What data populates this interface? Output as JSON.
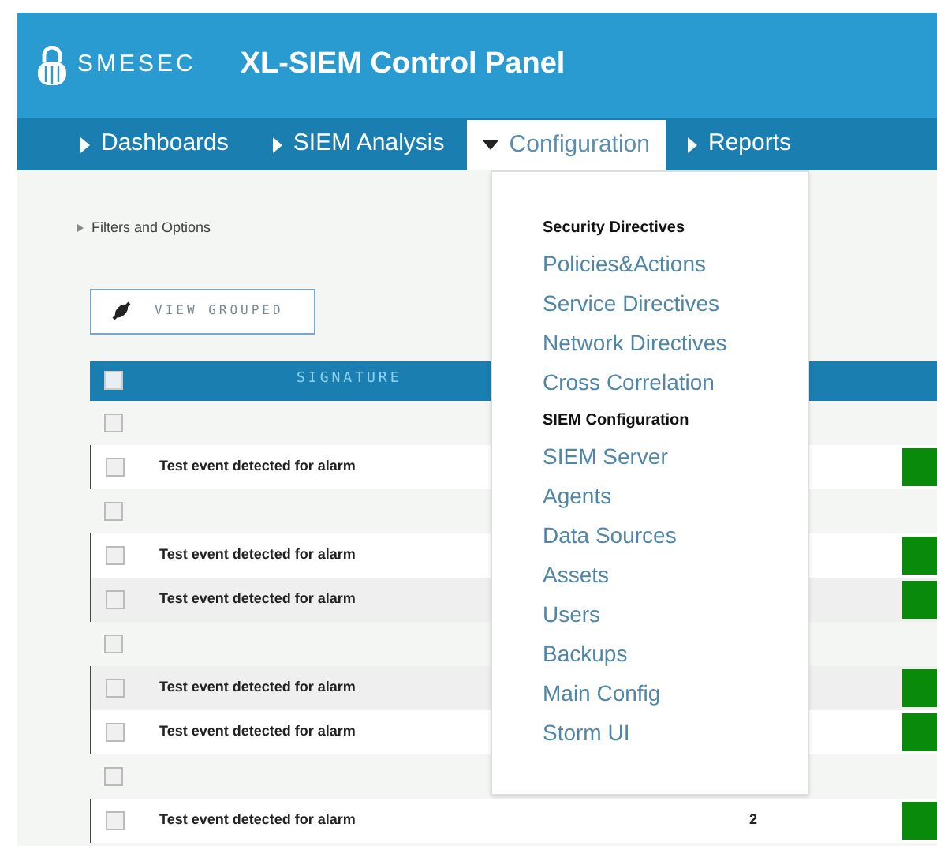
{
  "header": {
    "logo_text": "SMESEC",
    "title": "XL-SIEM Control Panel"
  },
  "nav": [
    {
      "label": "Dashboards",
      "expanded": false
    },
    {
      "label": "SIEM Analysis",
      "expanded": false
    },
    {
      "label": "Configuration",
      "expanded": true
    },
    {
      "label": "Reports",
      "expanded": false
    }
  ],
  "filters_link": "Filters and Options",
  "view_grouped_button": "VIEW GROUPED",
  "table": {
    "columns": [
      "SIGNATURE"
    ],
    "select_all_checked": false,
    "rows": [
      {
        "kind": "group",
        "checked": false
      },
      {
        "kind": "event",
        "signature": "Test event detected for alarm",
        "checked": false
      },
      {
        "kind": "group",
        "checked": false
      },
      {
        "kind": "event",
        "signature": "Test event detected for alarm",
        "checked": false
      },
      {
        "kind": "event",
        "signature": "Test event detected for alarm",
        "checked": false
      },
      {
        "kind": "group",
        "checked": false
      },
      {
        "kind": "event",
        "signature": "Test event detected for alarm",
        "checked": false
      },
      {
        "kind": "event",
        "signature": "Test event detected for alarm",
        "checked": false
      },
      {
        "kind": "group",
        "checked": false
      },
      {
        "kind": "event",
        "signature": "Test event detected for alarm",
        "count": "2",
        "checked": false
      }
    ]
  },
  "dropdown": {
    "sections": [
      {
        "heading": "Security Directives",
        "items": [
          "Policies&Actions",
          "Service Directives",
          "Network Directives",
          "Cross Correlation"
        ]
      },
      {
        "heading": "SIEM Configuration",
        "items": [
          "SIEM Server",
          "Agents",
          "Data Sources",
          "Assets",
          "Users",
          "Backups",
          "Main Config",
          "Storm UI"
        ]
      }
    ]
  }
}
